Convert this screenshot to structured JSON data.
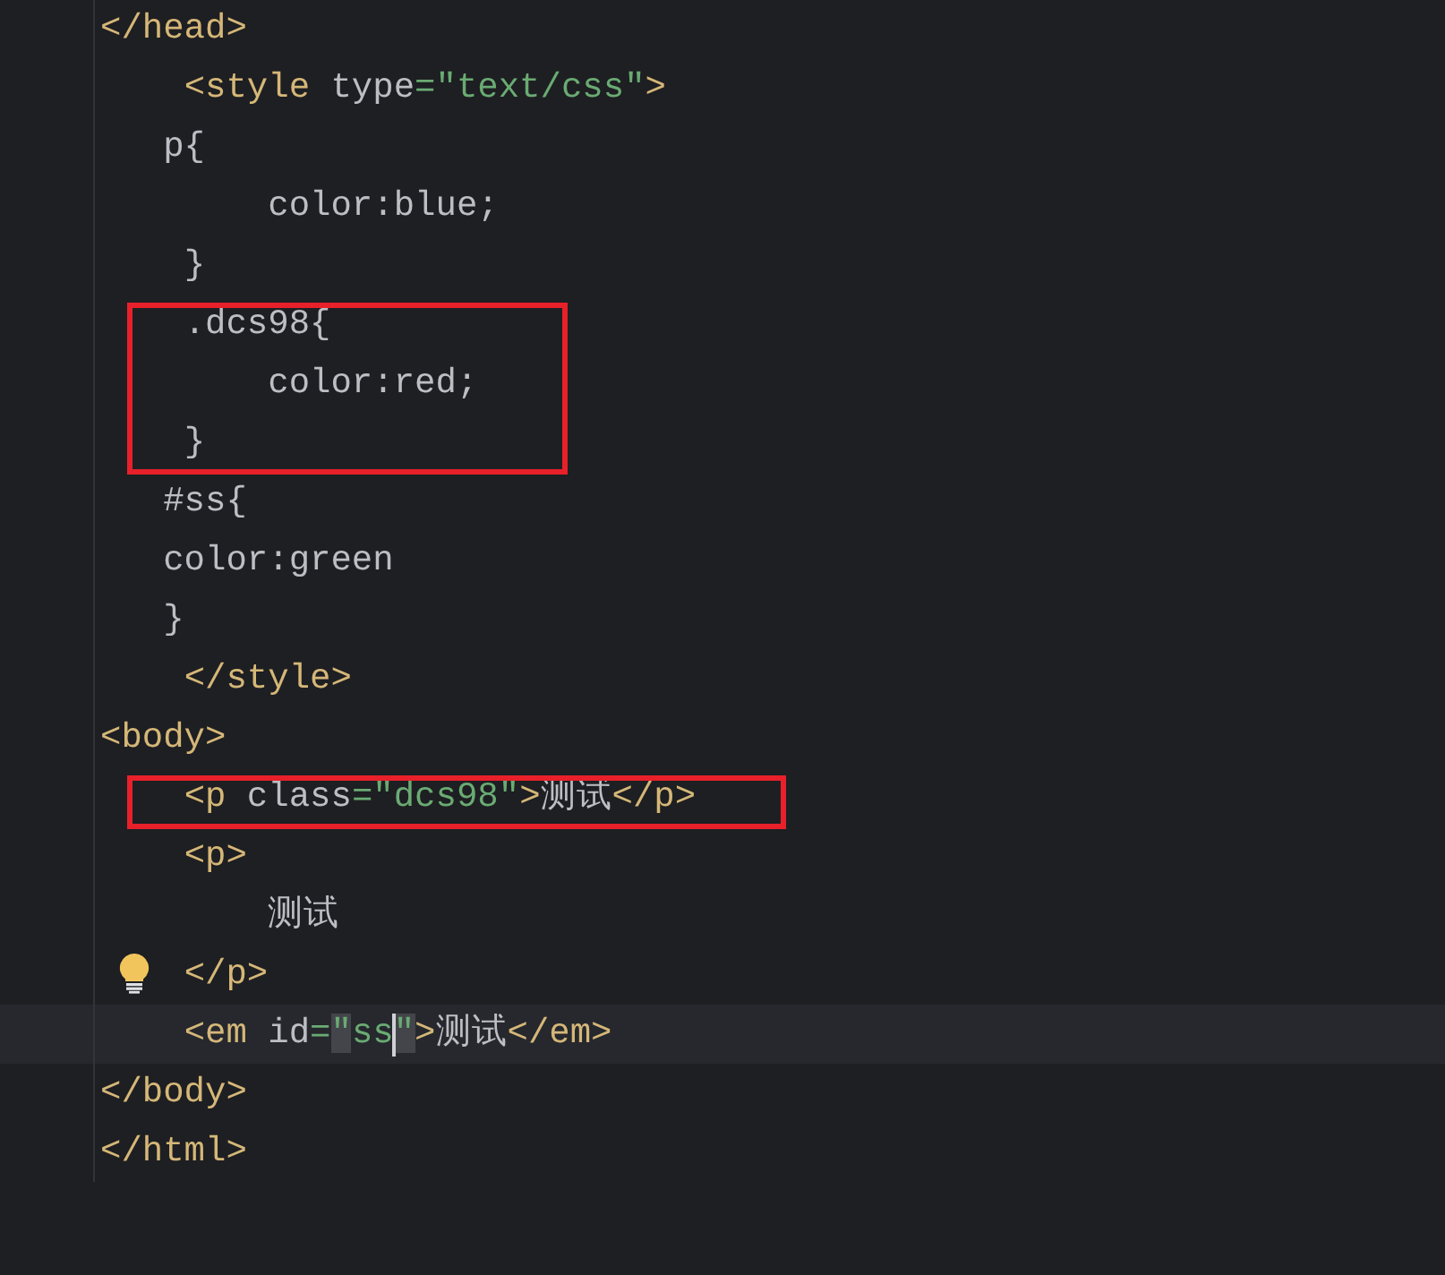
{
  "editor": {
    "lines": [
      {
        "tokens": [
          {
            "kind": "tag",
            "text": "</head>"
          }
        ]
      },
      {
        "tokens": [
          {
            "kind": "tag",
            "text": "    <style "
          },
          {
            "kind": "attr",
            "text": "type"
          },
          {
            "kind": "value",
            "text": "=\"text/css\""
          },
          {
            "kind": "tag",
            "text": ">"
          }
        ]
      },
      {
        "tokens": [
          {
            "kind": "text",
            "text": "   p{"
          }
        ]
      },
      {
        "tokens": [
          {
            "kind": "text",
            "text": "        color:blue;"
          }
        ]
      },
      {
        "tokens": [
          {
            "kind": "text",
            "text": "    }"
          }
        ]
      },
      {
        "boxed": true,
        "tokens": [
          {
            "kind": "text",
            "text": "    .dcs98{"
          }
        ]
      },
      {
        "boxed": true,
        "tokens": [
          {
            "kind": "text",
            "text": "        color:red;"
          }
        ]
      },
      {
        "boxed": true,
        "tokens": [
          {
            "kind": "text",
            "text": "    }"
          }
        ]
      },
      {
        "tokens": [
          {
            "kind": "text",
            "text": "   #ss{"
          }
        ]
      },
      {
        "tokens": [
          {
            "kind": "text",
            "text": "   color:green"
          }
        ]
      },
      {
        "tokens": [
          {
            "kind": "text",
            "text": "   }"
          }
        ]
      },
      {
        "tokens": [
          {
            "kind": "tag",
            "text": "    </style>"
          }
        ]
      },
      {
        "tokens": [
          {
            "kind": "tag",
            "text": "<body>"
          }
        ]
      },
      {
        "boxed": true,
        "tokens": [
          {
            "kind": "tag",
            "text": "    <p "
          },
          {
            "kind": "attr",
            "text": "class"
          },
          {
            "kind": "value",
            "text": "=\"dcs98\""
          },
          {
            "kind": "tag",
            "text": ">"
          },
          {
            "kind": "text",
            "text": "测试"
          },
          {
            "kind": "tag",
            "text": "</p>"
          }
        ]
      },
      {
        "tokens": [
          {
            "kind": "tag",
            "text": "    <p>"
          }
        ]
      },
      {
        "tokens": [
          {
            "kind": "text",
            "text": "        测试"
          }
        ]
      },
      {
        "bulb": true,
        "tokens": [
          {
            "kind": "tag",
            "text": "    </p>"
          }
        ]
      },
      {
        "current": true,
        "tokens": [
          {
            "kind": "tag",
            "text": "    <em "
          },
          {
            "kind": "attr",
            "text": "id"
          },
          {
            "kind": "value",
            "text": "="
          },
          {
            "kind": "value",
            "text": "\"",
            "match": true
          },
          {
            "kind": "value",
            "text": "ss",
            "caret_after": true
          },
          {
            "kind": "value",
            "text": "\"",
            "match": true
          },
          {
            "kind": "tag",
            "text": ">"
          },
          {
            "kind": "text",
            "text": "测试"
          },
          {
            "kind": "tag",
            "text": "</em>"
          }
        ]
      },
      {
        "tokens": [
          {
            "kind": "tag",
            "text": "</body>"
          }
        ]
      },
      {
        "tokens": [
          {
            "kind": "tag",
            "text": "</html>"
          }
        ]
      }
    ]
  }
}
